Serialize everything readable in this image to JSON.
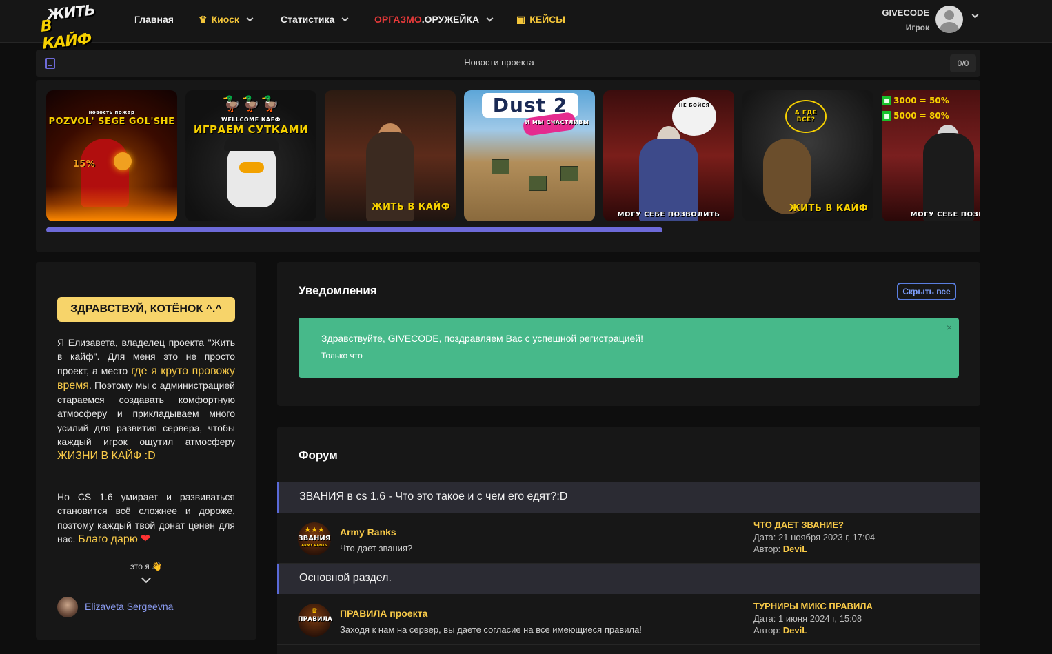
{
  "header": {
    "logo_line1": "ЖИТЬ",
    "logo_line2": "В КАЙФ",
    "nav": {
      "home": "Главная",
      "kiosk": "Киоск",
      "stats": "Статистика",
      "weapon_red": "ОРГАЗМО",
      "weapon_rest": ".ОРУЖЕЙКА",
      "cases": "КЕЙСЫ"
    },
    "user": {
      "name": "GIVECODE",
      "role": "Игрок"
    }
  },
  "news": {
    "title": "Новости проекта",
    "count": "0/0"
  },
  "carousel": {
    "slides": [
      {
        "top": "новость пожар",
        "caption": "POZVOL' SEGE GOL'SHE",
        "badge": "15%"
      },
      {
        "top": "WELLCOME КАЕФ",
        "caption": "ИГРАЕМ СУТКАМИ"
      },
      {
        "caption": "ЖИТЬ В КАЙФ"
      },
      {
        "title": "Dust 2",
        "tag": "И МЫ СЧАСТЛИВЫ"
      },
      {
        "bubble": "НЕ БОЙСЯ",
        "caption": "МОГУ СЕБЕ ПОЗВОЛИТЬ"
      },
      {
        "bubble": "А ГДЕ ВСЁ?",
        "caption": "ЖИТЬ В КАЙФ"
      },
      {
        "promo1_a": "3000",
        "promo1_b": "50%",
        "promo2_a": "5000",
        "promo2_b": "80%",
        "caption": "МОГУ СЕБЕ ПОЗВ"
      }
    ],
    "progress": 0.662
  },
  "left": {
    "greeting": "ЗДРАВСТВУЙ, КОТЁНОК ^.^",
    "p1_a": "Я Елизавета, владелец проекта \"Жить в кайф\". Для меня это не просто проект, а место ",
    "p1_hl1": "где я круто провожу время",
    "p1_b": ". Поэтому мы с администрацией стараемся создавать комфортную атмосферу и прикладываем много усилий для развития сервера, чтобы каждый игрок ощутил атмосферу ",
    "p1_hl2": "ЖИЗНИ В КАЙФ :D",
    "p2_a": "Но CS 1.6 умирает и развиваться становится всё сложнее и дороже, поэтому каждый твой донат ценен для нас. ",
    "p2_hl": "Благо дарю",
    "heart": "❤",
    "its_me": "это я 👋",
    "author": "Elizaveta Sergeevna"
  },
  "notifications": {
    "title": "Уведомления",
    "hide_all": "Скрыть все",
    "alert_message": "Здравствуйте, GIVECODE, поздравляем Вас с успешной регистрацией!",
    "alert_time": "Только что",
    "close": "×"
  },
  "forum": {
    "title": "Форум",
    "categories": [
      {
        "name": "ЗВАНИЯ в cs 1.6 - Что это такое и с чем его едят?:D",
        "forum": {
          "icon_text": "ЗВАНИЯ",
          "icon_sub": "ARMY RANKS",
          "title": "Army Ranks",
          "desc": "Что дает звания?",
          "last_title": "ЧТО ДАЕТ ЗВАНИЕ?",
          "last_date": "Дата: 21 ноября 2023 г, 17:04",
          "last_author_label": "Автор: ",
          "last_author": "DeviL"
        }
      },
      {
        "name": "Основной раздел.",
        "forum": {
          "icon_text": "ПРАВИЛА",
          "title": "ПРАВИЛА проекта",
          "desc": "Заходя к нам на сервер, вы даете согласие на все имеющиеся правила!",
          "last_title": "ТУРНИРЫ МИКС ПРАВИЛА",
          "last_date": "Дата: 1 июня 2024 г, 15:08",
          "last_author_label": "Автор: ",
          "last_author": "DeviL"
        }
      }
    ]
  }
}
